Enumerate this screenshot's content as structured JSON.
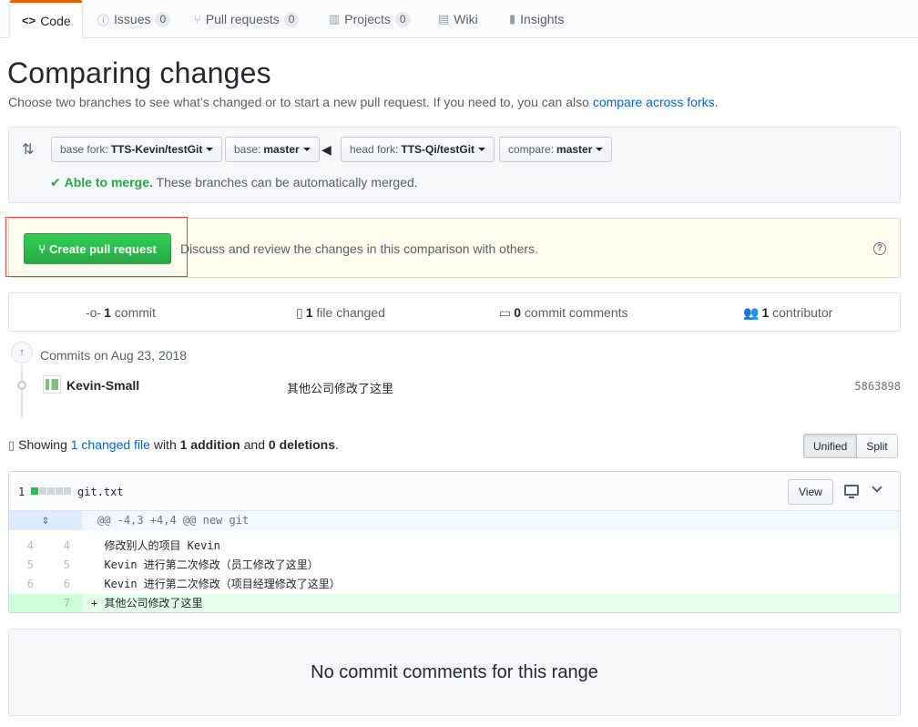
{
  "tabs": [
    {
      "label": "Code",
      "icon": "code-icon",
      "counter": null
    },
    {
      "label": "Issues",
      "icon": "issue-icon",
      "counter": "0"
    },
    {
      "label": "Pull requests",
      "icon": "pull-request-icon",
      "counter": "0"
    },
    {
      "label": "Projects",
      "icon": "project-icon",
      "counter": "0"
    },
    {
      "label": "Wiki",
      "icon": "book-icon",
      "counter": null
    },
    {
      "label": "Insights",
      "icon": "graph-icon",
      "counter": null
    }
  ],
  "header": {
    "title": "Comparing changes",
    "subtitle": "Choose two branches to see what’s changed or to start a new pull request. If you need to, you can also ",
    "subtitle_link": "compare across forks",
    "subtitle_end": "."
  },
  "range": {
    "base_fork_label": "base fork:",
    "base_fork_value": "TTS-Kevin/testGit",
    "base_label": "base:",
    "base_value": "master",
    "head_fork_label": "head fork:",
    "head_fork_value": "TTS-Qi/testGit",
    "compare_label": "compare:",
    "compare_value": "master",
    "merge_status": "Able to merge.",
    "merge_text": " These branches can be automatically merged."
  },
  "create_pr": {
    "button_label": "Create pull request",
    "text": "Discuss and review the changes in this comparison with others."
  },
  "summary": {
    "commits_count": "1",
    "commits_label": " commit",
    "files_count": "1",
    "files_label": " file changed",
    "comments_count": "0",
    "comments_label": " commit comments",
    "contributors_count": "1",
    "contributors_label": " contributor"
  },
  "commits": {
    "group_title": "Commits on Aug 23, 2018",
    "items": [
      {
        "author": "Kevin-Small",
        "message": "其他公司修改了这里",
        "sha": "5863898"
      }
    ]
  },
  "diff_toolbar": {
    "showing_prefix": "Showing ",
    "changed_files_link": "1 changed file",
    "with_text": " with ",
    "additions": "1 addition",
    "and_text": " and ",
    "deletions": "0 deletions",
    "end": ".",
    "unified_label": "Unified",
    "split_label": "Split"
  },
  "file": {
    "change_count": "1",
    "name": "git.txt",
    "view_label": "View",
    "hunk_header": "@@ -4,3 +4,4 @@ new git",
    "lines": [
      {
        "old": "4",
        "new": "4",
        "code": "  修改别人的项目 Kevin",
        "type": "context"
      },
      {
        "old": "5",
        "new": "5",
        "code": "  Kevin 进行第二次修改（员工修改了这里）",
        "type": "context"
      },
      {
        "old": "6",
        "new": "6",
        "code": "  Kevin 进行第二次修改（项目经理修改了这里）",
        "type": "context"
      },
      {
        "old": "",
        "new": "7",
        "code": "+ 其他公司修改了这里",
        "type": "add"
      }
    ]
  },
  "no_comments": "No commit comments for this range",
  "colors": {
    "accent_orange": "#e36209",
    "green": "#28a745",
    "link": "#0366d6",
    "highlight_red": "#e8443a"
  }
}
